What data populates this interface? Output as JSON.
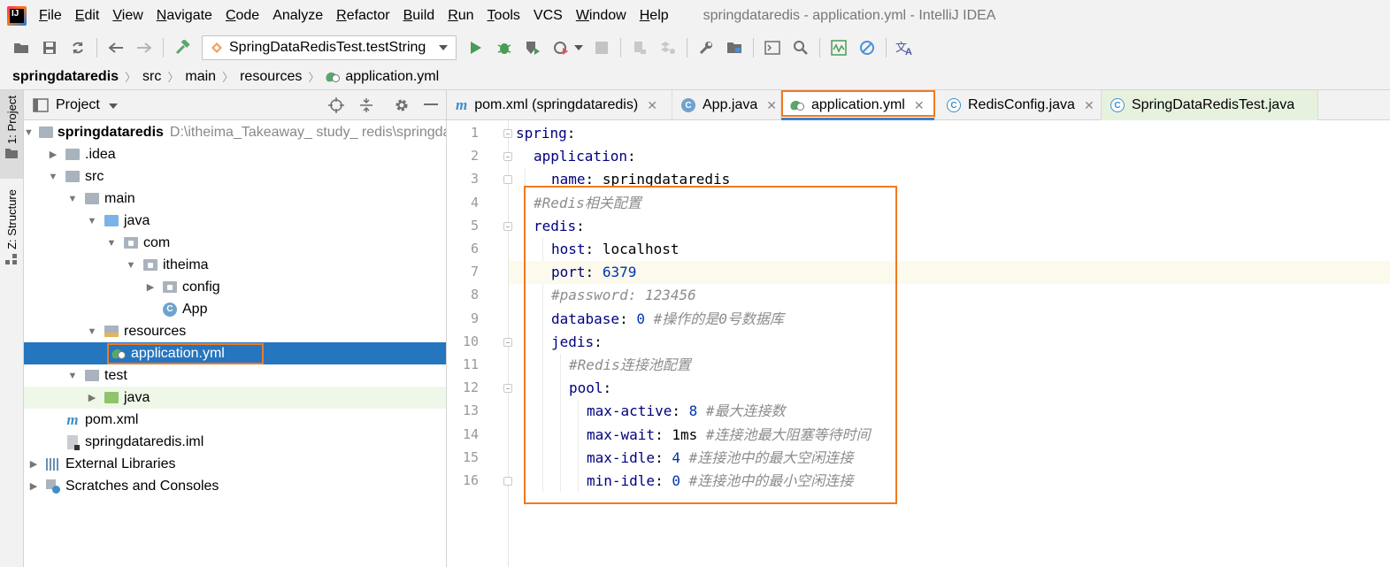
{
  "menubar": {
    "items": [
      {
        "mnemonic": "F",
        "rest": "ile"
      },
      {
        "mnemonic": "E",
        "rest": "dit"
      },
      {
        "mnemonic": "V",
        "rest": "iew"
      },
      {
        "mnemonic": "N",
        "rest": "avigate"
      },
      {
        "mnemonic": "C",
        "rest": "ode"
      },
      {
        "mnemonic": "",
        "rest": "Analyze"
      },
      {
        "mnemonic": "R",
        "rest": "efactor"
      },
      {
        "mnemonic": "B",
        "rest": "uild"
      },
      {
        "mnemonic": "R",
        "rest": "un"
      },
      {
        "mnemonic": "T",
        "rest": "ools"
      },
      {
        "mnemonic": "",
        "rest": "VCS"
      },
      {
        "mnemonic": "W",
        "rest": "indow"
      },
      {
        "mnemonic": "H",
        "rest": "elp"
      }
    ],
    "window_title": "springdataredis - application.yml - IntelliJ IDEA"
  },
  "toolbar": {
    "run_config": "SpringDataRedisTest.testString"
  },
  "breadcrumb": [
    "springdataredis",
    "src",
    "main",
    "resources",
    "application.yml"
  ],
  "stripe": {
    "project": "1: Project",
    "structure": "Z: Structure"
  },
  "project_panel": {
    "title": "Project",
    "tree": [
      {
        "label": "springdataredis",
        "hint": "D:\\itheima_Takeaway_ study_ redis\\springdataredis"
      },
      {
        "label": ".idea"
      },
      {
        "label": "src"
      },
      {
        "label": "main"
      },
      {
        "label": "java"
      },
      {
        "label": "com"
      },
      {
        "label": "itheima"
      },
      {
        "label": "config"
      },
      {
        "label": "App"
      },
      {
        "label": "resources"
      },
      {
        "label": "application.yml"
      },
      {
        "label": "test"
      },
      {
        "label": "java"
      },
      {
        "label": "pom.xml"
      },
      {
        "label": "springdataredis.iml"
      },
      {
        "label": "External Libraries"
      },
      {
        "label": "Scratches and Consoles"
      }
    ]
  },
  "editor": {
    "tabs": [
      {
        "label": "pom.xml (springdataredis)"
      },
      {
        "label": "App.java"
      },
      {
        "label": "application.yml"
      },
      {
        "label": "RedisConfig.java"
      },
      {
        "label": "SpringDataRedisTest.java"
      }
    ],
    "line_numbers": [
      "1",
      "2",
      "3",
      "4",
      "5",
      "6",
      "7",
      "8",
      "9",
      "10",
      "11",
      "12",
      "13",
      "14",
      "15",
      "16"
    ],
    "lines": [
      {
        "key": "spring",
        "value": "",
        "comment": ""
      },
      {
        "key": "application",
        "value": "",
        "comment": ""
      },
      {
        "key": "name",
        "value": "springdataredis",
        "comment": ""
      },
      {
        "key": "",
        "value": "",
        "comment": "#Redis相关配置"
      },
      {
        "key": "redis",
        "value": "",
        "comment": ""
      },
      {
        "key": "host",
        "value": "localhost",
        "comment": ""
      },
      {
        "key": "port",
        "value": "6379",
        "comment": ""
      },
      {
        "key": "",
        "value": "",
        "comment": "#password: 123456"
      },
      {
        "key": "database",
        "value": "0",
        "comment": "#操作的是0号数据库"
      },
      {
        "key": "jedis",
        "value": "",
        "comment": ""
      },
      {
        "key": "",
        "value": "",
        "comment": "#Redis连接池配置"
      },
      {
        "key": "pool",
        "value": "",
        "comment": ""
      },
      {
        "key": "max-active",
        "value": "8",
        "comment": "#最大连接数"
      },
      {
        "key": "max-wait",
        "value": "1ms",
        "comment": "#连接池最大阻塞等待时间"
      },
      {
        "key": "max-idle",
        "value": "4",
        "comment": "#连接池中的最大空闲连接"
      },
      {
        "key": "min-idle",
        "value": "0",
        "comment": "#连接池中的最小空闲连接"
      }
    ],
    "colon": ":"
  },
  "colors": {
    "highlight_box": "#f07a1e",
    "selection": "#2675bf",
    "yaml_key": "#000080",
    "number": "#0033b3",
    "comment": "#8c8c8c"
  }
}
